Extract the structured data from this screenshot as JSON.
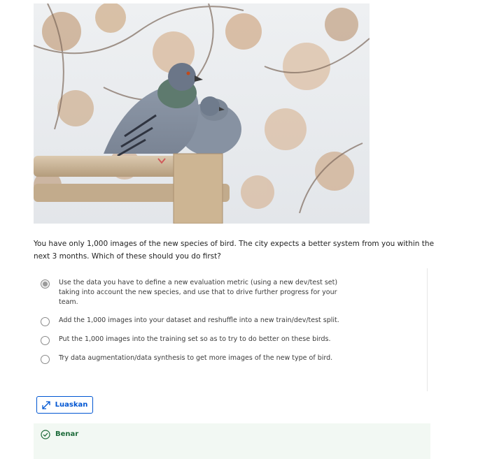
{
  "image": {
    "icon": "pigeons-photo"
  },
  "question": {
    "text": "You have only 1,000 images of the new species of bird. The city expects a better system from you within the next 3 months. Which of these should you do first?"
  },
  "options": [
    {
      "label": "Use the data you have to define a new evaluation metric (using a new dev/test set) taking into account the new species, and use that to drive further progress for your team.",
      "selected": true
    },
    {
      "label": "Add the 1,000 images into your dataset and reshuffle into a new train/dev/test split.",
      "selected": false
    },
    {
      "label": "Put the 1,000 images into the training set so as to try to do better on these birds.",
      "selected": false
    },
    {
      "label": "Try data augmentation/data synthesis to get more images of the new type of bird.",
      "selected": false
    }
  ],
  "expand_button": {
    "label": "Luaskan",
    "icon": "expand-arrows-icon"
  },
  "result": {
    "label": "Benar",
    "icon": "check-circle-icon",
    "color": "#1d6b3a"
  },
  "colors": {
    "accent": "#0056d2",
    "success_bg": "#f2f8f3"
  }
}
